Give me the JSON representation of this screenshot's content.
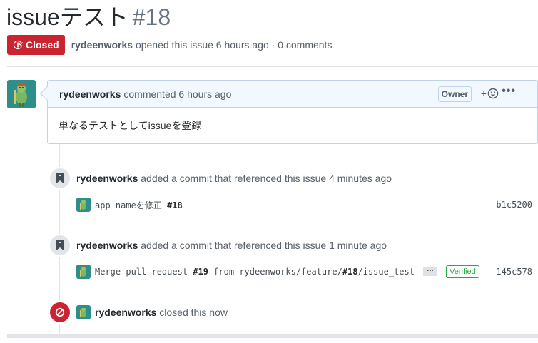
{
  "issue": {
    "title": "issueテスト",
    "number": "#18",
    "state": "Closed",
    "author": "rydeenworks",
    "meta_text": "opened this issue 6 hours ago · 0 comments"
  },
  "comment": {
    "author": "rydeenworks",
    "action": "commented 6 hours ago",
    "role_badge": "Owner",
    "reaction_label": "+",
    "more_label": "•••",
    "body": "単なるテストとしてissueを登録"
  },
  "events": [
    {
      "author": "rydeenworks",
      "text": "added a commit that referenced this issue 4 minutes ago",
      "commit": {
        "message": "app_nameを修正 ",
        "ref": "#18",
        "sha": "b1c5200"
      }
    },
    {
      "author": "rydeenworks",
      "text": "added a commit that referenced this issue 1 minute ago",
      "commit": {
        "message_pre": "Merge pull request ",
        "ref1": "#19",
        "message_mid": " from rydeenworks/feature/",
        "ref2": "#18",
        "message_post": "/issue_test",
        "ellipsis": "…",
        "verified": "Verified",
        "sha": "145c578"
      }
    }
  ],
  "closed_event": {
    "author": "rydeenworks",
    "text": "closed this now"
  },
  "colors": {
    "closed_red": "#cb2431",
    "avatar_teal": "#2e8e8a",
    "header_blue": "#f1f8ff",
    "verified_green": "#28a745"
  }
}
